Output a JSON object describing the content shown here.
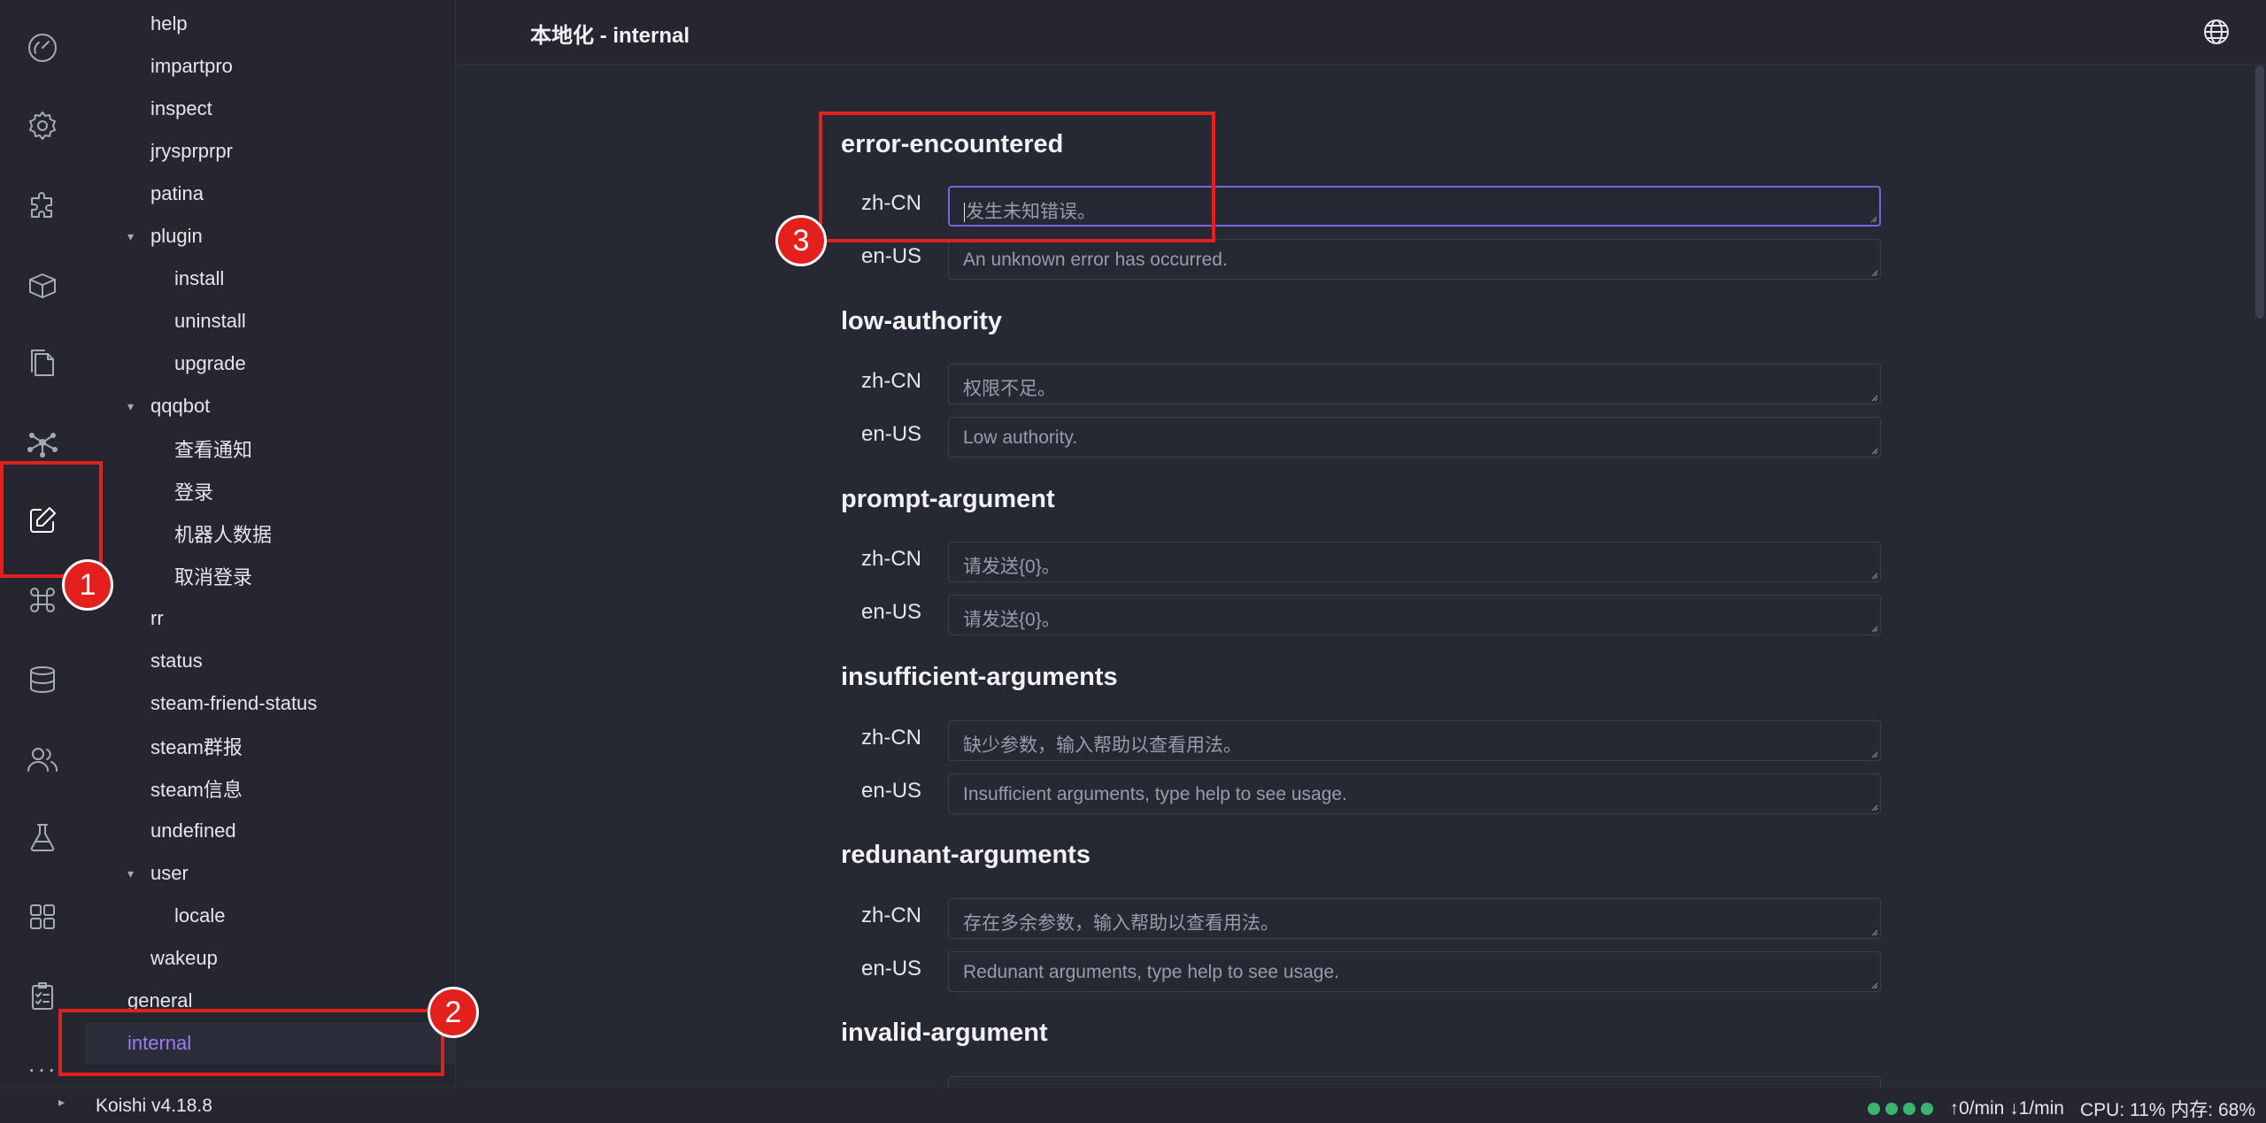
{
  "activity_bar": {
    "items": [
      {
        "name": "dashboard-icon"
      },
      {
        "name": "settings-icon"
      },
      {
        "name": "plugins-icon"
      },
      {
        "name": "market-icon"
      },
      {
        "name": "logs-icon"
      },
      {
        "name": "dependencies-icon"
      },
      {
        "name": "locales-icon",
        "active": true
      },
      {
        "name": "commands-icon"
      },
      {
        "name": "database-icon"
      },
      {
        "name": "users-icon"
      },
      {
        "name": "sandbox-icon"
      },
      {
        "name": "apps-icon"
      },
      {
        "name": "checklist-icon"
      }
    ],
    "more": "···"
  },
  "sidebar": {
    "items": [
      {
        "label": "help",
        "level": 1
      },
      {
        "label": "impartpro",
        "level": 1
      },
      {
        "label": "inspect",
        "level": 1
      },
      {
        "label": "jrysprprpr",
        "level": 1
      },
      {
        "label": "patina",
        "level": 1
      },
      {
        "label": "plugin",
        "level": 1,
        "expanded": true
      },
      {
        "label": "install",
        "level": 2
      },
      {
        "label": "uninstall",
        "level": 2
      },
      {
        "label": "upgrade",
        "level": 2
      },
      {
        "label": "qqqbot",
        "level": 1,
        "expanded": true
      },
      {
        "label": "查看通知",
        "level": 2
      },
      {
        "label": "登录",
        "level": 2
      },
      {
        "label": "机器人数据",
        "level": 2
      },
      {
        "label": "取消登录",
        "level": 2
      },
      {
        "label": "rr",
        "level": 1
      },
      {
        "label": "status",
        "level": 1
      },
      {
        "label": "steam-friend-status",
        "level": 1
      },
      {
        "label": "steam群报",
        "level": 1
      },
      {
        "label": "steam信息",
        "level": 1
      },
      {
        "label": "undefined",
        "level": 1
      },
      {
        "label": "user",
        "level": 1,
        "expanded": true
      },
      {
        "label": "locale",
        "level": 2
      },
      {
        "label": "wakeup",
        "level": 1
      },
      {
        "label": "general",
        "level": 0
      },
      {
        "label": "internal",
        "level": 0,
        "selected": true
      }
    ]
  },
  "header": {
    "title": "本地化 - internal",
    "globe_icon": "globe-icon"
  },
  "sections": [
    {
      "key": "error-encountered",
      "zh": "发生未知错误。",
      "en": "An unknown error has occurred.",
      "zh_focused": true
    },
    {
      "key": "low-authority",
      "zh": "权限不足。",
      "en": "Low authority."
    },
    {
      "key": "prompt-argument",
      "zh": "请发送{0}。",
      "en": "请发送{0}。"
    },
    {
      "key": "insufficient-arguments",
      "zh": "缺少参数，输入帮助以查看用法。",
      "en": "Insufficient arguments, type help to see usage."
    },
    {
      "key": "redunant-arguments",
      "zh": "存在多余参数，输入帮助以查看用法。",
      "en": "Redunant arguments, type help to see usage."
    },
    {
      "key": "invalid-argument",
      "zh": "",
      "en": ""
    }
  ],
  "locale_labels": {
    "zh": "zh-CN",
    "en": "en-US"
  },
  "annotations": {
    "badge1": "1",
    "badge2": "2",
    "badge3": "3"
  },
  "status_bar": {
    "version": "Koishi v4.18.8",
    "toggle": "▸",
    "traffic": "↑0/min ↓1/min",
    "cpu_mem": "CPU: 11% 内存: 68%",
    "indicator_color": "#3cb371"
  },
  "colors": {
    "accent": "#9b7cf4",
    "annotation": "#e3201b"
  }
}
